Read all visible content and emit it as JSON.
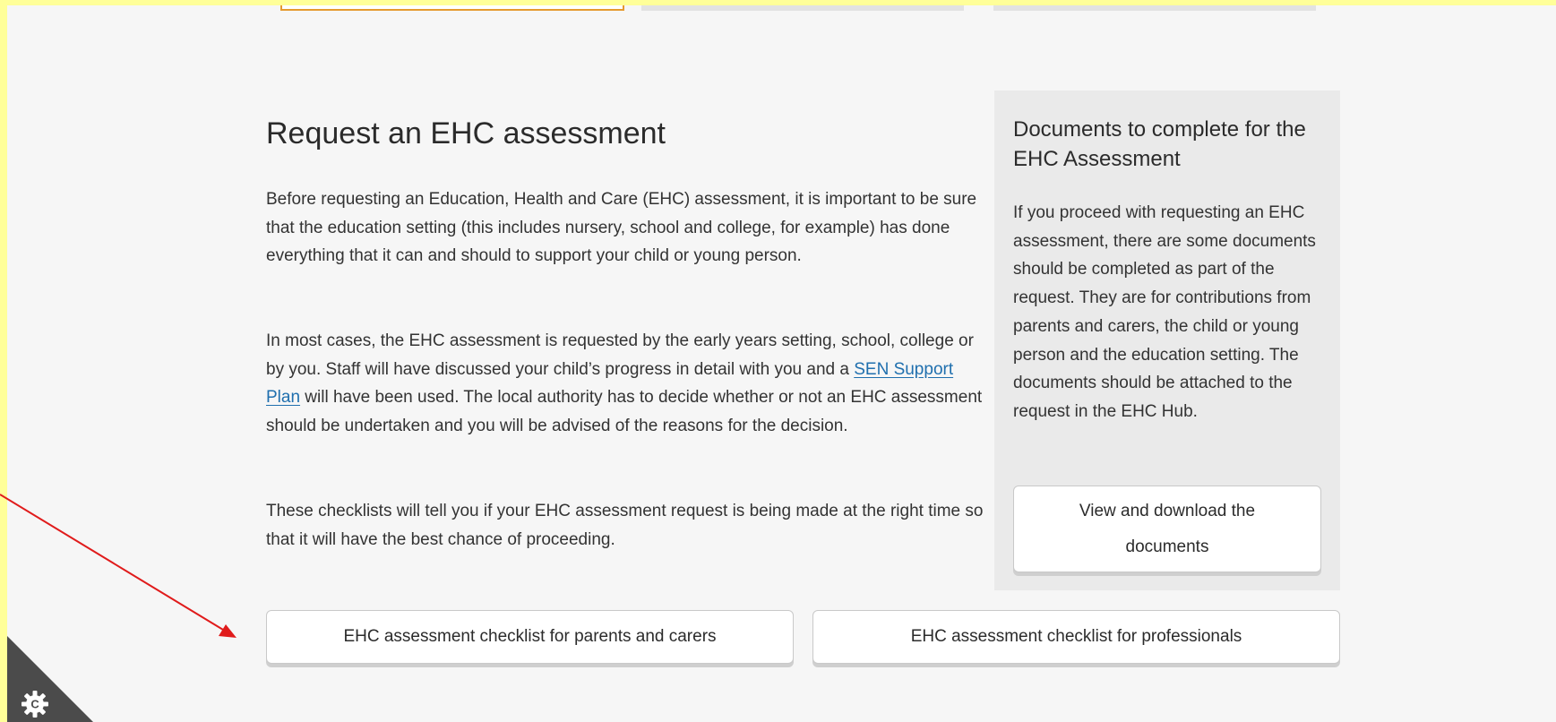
{
  "main": {
    "title": "Request an EHC assessment",
    "paragraph1": "Before requesting an Education, Health and Care (EHC) assessment, it is important to be sure that the education setting (this includes nursery, school and college, for example) has done everything that it can and should to support your child or young person.",
    "paragraph2_before": "In most cases, the EHC assessment is requested by the early years setting, school, college or by you. Staff will have discussed your child’s progress in detail with you and a ",
    "paragraph2_link": "SEN Support Plan",
    "paragraph2_after": " will have been used. The local authority has to decide whether or not an EHC assessment should be undertaken and you will be advised of the reasons for the decision.",
    "paragraph3": "These checklists will tell you if your EHC assessment request is being made at the right time so that it will have the best chance of proceeding."
  },
  "sidebar": {
    "title": "Documents to complete for the EHC Assessment",
    "body": "If you proceed with requesting an EHC assessment, there are some documents should be completed as part of the request. They are for contributions from parents and carers, the child or young person and the education setting. The documents should be attached to the request in the EHC Hub.",
    "button_label": "View and download the documents"
  },
  "checklists": {
    "parents_label": "EHC assessment checklist for parents and carers",
    "professionals_label": "EHC assessment checklist for professionals"
  },
  "icons": {
    "cookie_settings": "gear-icon"
  },
  "colors": {
    "link": "#1f6fae",
    "annotation_arrow": "#e01b1b",
    "active_tab_border": "#e59a2e",
    "outer_highlight": "#ffff99"
  }
}
